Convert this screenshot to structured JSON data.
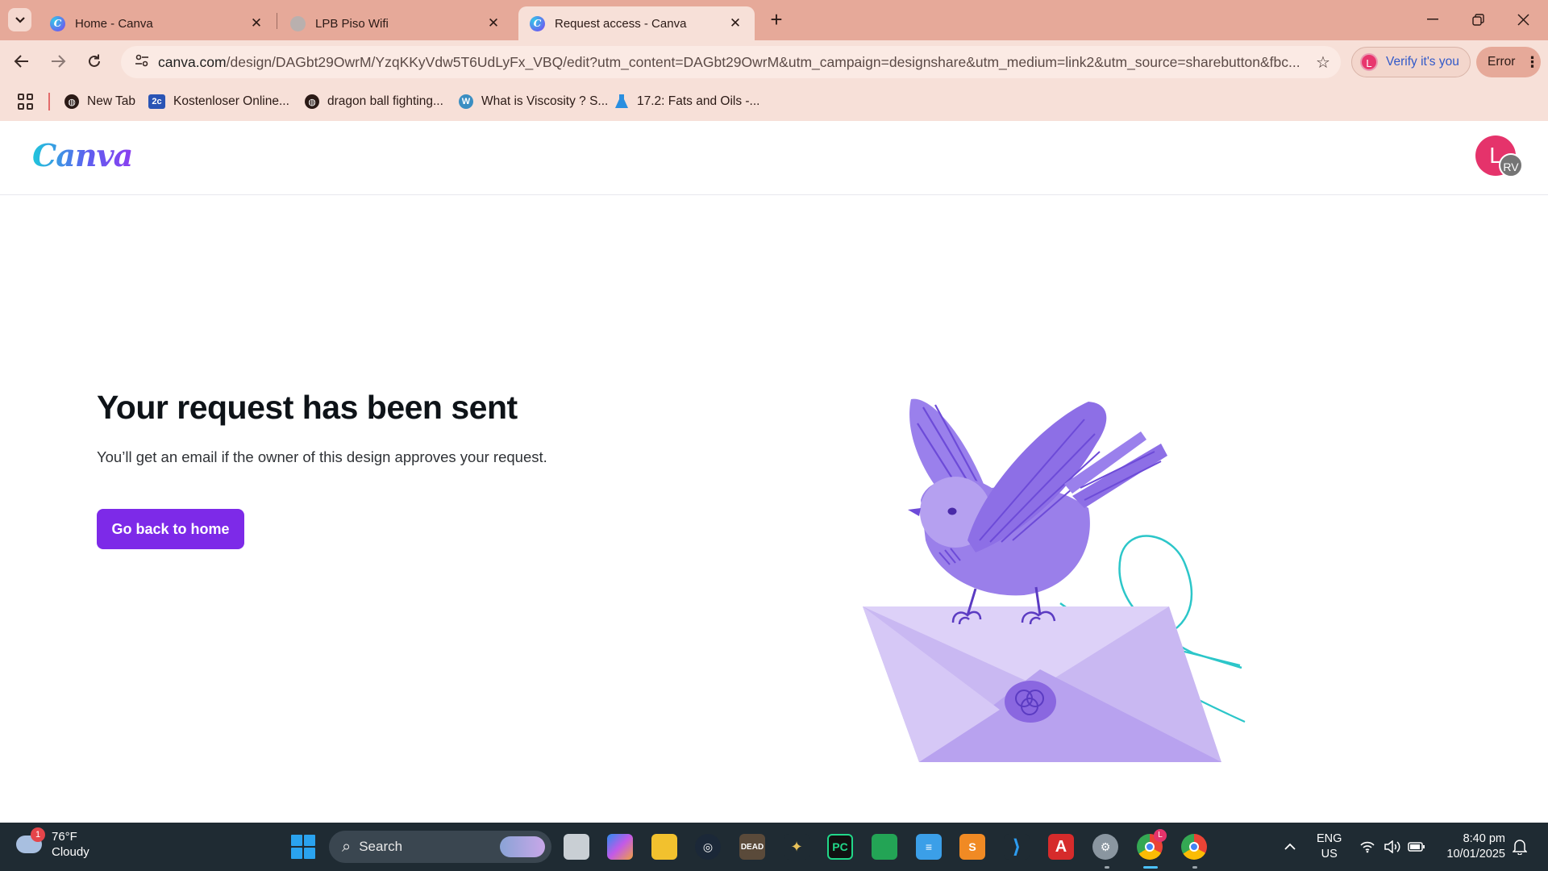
{
  "browser": {
    "tabs": [
      {
        "title": "Home - Canva",
        "favicon": "canva-icon"
      },
      {
        "title": "LPB Piso Wifi",
        "favicon": "globe-icon"
      },
      {
        "title": "Request access - Canva",
        "favicon": "canva-icon"
      }
    ],
    "url_host": "canva.com",
    "url_path": "/design/DAGbt29OwrM/YzqKKyVdw5T6UdLyFx_VBQ/edit?utm_content=DAGbt29OwrM&utm_campaign=designshare&utm_medium=link2&utm_source=sharebutton&fbc...",
    "verify_label": "Verify it's you",
    "verify_avatar": "L",
    "error_label": "Error",
    "bookmarks": [
      {
        "label": "New Tab",
        "icon": "globe-icon",
        "color": "#2b1a16"
      },
      {
        "label": "Kostenloser Online...",
        "icon": "2c-icon",
        "color": "#2a54b5",
        "glyph": "2c"
      },
      {
        "label": "dragon ball fighting...",
        "icon": "globe-icon",
        "color": "#2b1a16"
      },
      {
        "label": "What is Viscosity ? S...",
        "icon": "wordpress-icon",
        "color": "#3a8ec2",
        "glyph": "W"
      },
      {
        "label": "17.2: Fats and Oils -...",
        "icon": "flask-icon",
        "color": "#2a8fe0"
      }
    ]
  },
  "canva": {
    "logo": "Canva",
    "avatar_initial": "L",
    "avatar_badge": "RV",
    "headline": "Your request has been sent",
    "subtext": "You’ll get an email if the owner of this design approves your request.",
    "home_button": "Go back to home",
    "accent": "#7d2ae8"
  },
  "taskbar": {
    "weather_temp": "76°F",
    "weather_desc": "Cloudy",
    "weather_badge": "1",
    "search_label": "Search",
    "lang_top": "ENG",
    "lang_bottom": "US",
    "time": "8:40 pm",
    "date": "10/01/2025",
    "chrome_badge": "L"
  }
}
